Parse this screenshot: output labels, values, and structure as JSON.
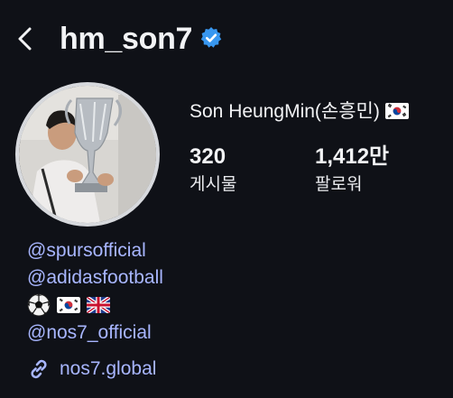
{
  "header": {
    "username": "hm_son7",
    "back_icon": "chevron-left-icon",
    "verified_icon": "verified-badge-icon",
    "accent_color": "#3897f0"
  },
  "profile": {
    "full_name": "Son HeungMin(손흥민)",
    "name_flag": "south-korea-flag",
    "posts_count": "320",
    "posts_label": "게시물",
    "followers_count": "1,412만",
    "followers_label": "팔로워"
  },
  "bio": {
    "mention_1": "@spursofficial",
    "mention_2": "@adidasfootball",
    "emoji_icons": [
      "soccer-ball-icon",
      "south-korea-flag",
      "uk-flag"
    ],
    "mention_3": "@nos7_official",
    "link_icon": "link-icon",
    "website": "nos7.global",
    "link_color": "#a8b6ff"
  }
}
